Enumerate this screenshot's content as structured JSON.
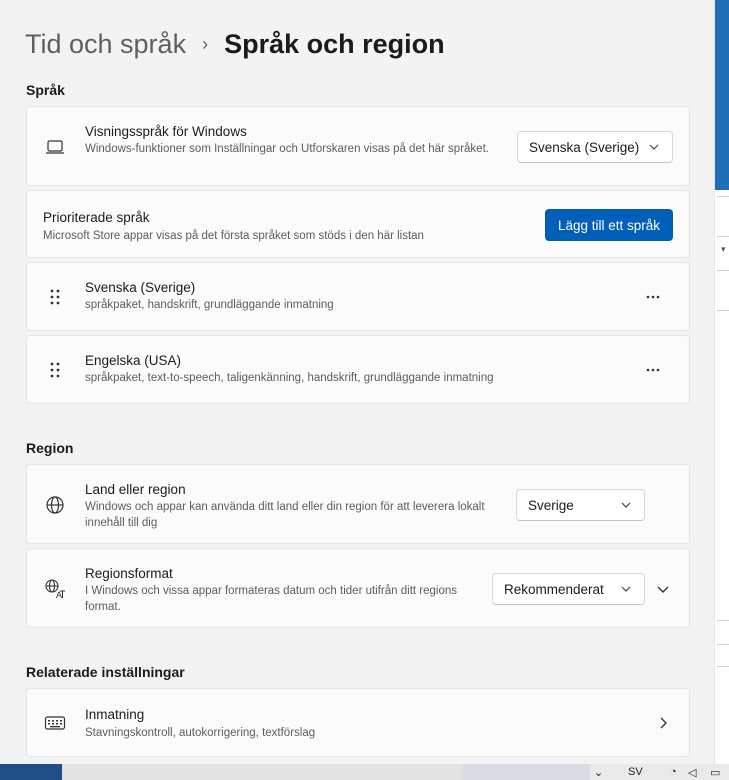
{
  "breadcrumb": {
    "parent": "Tid och språk",
    "separator": "›",
    "current": "Språk och region"
  },
  "sections": {
    "language": "Språk",
    "region": "Region",
    "related": "Relaterade inställningar"
  },
  "display_language": {
    "title": "Visningsspråk för Windows",
    "description": "Windows-funktioner som Inställningar och Utforskaren visas på det här språket.",
    "value": "Svenska (Sverige)",
    "icon": "laptop-icon"
  },
  "preferred_languages": {
    "title": "Prioriterade språk",
    "description": "Microsoft Store appar visas på det första språket som stöds i den här listan",
    "add_button": "Lägg till ett språk"
  },
  "languages": [
    {
      "name": "Svenska (Sverige)",
      "features": "språkpaket, handskrift, grundläggande inmatning"
    },
    {
      "name": "Engelska (USA)",
      "features": "språkpaket, text-to-speech, taligenkänning, handskrift, grundläggande inmatning"
    }
  ],
  "country": {
    "title": "Land eller region",
    "description": "Windows och appar kan använda ditt land eller din region för att leverera lokalt innehåll till dig",
    "value": "Sverige",
    "icon": "globe-icon"
  },
  "regional_format": {
    "title": "Regionsformat",
    "description": "I Windows och vissa appar formateras datum och tider utifrån ditt regions format.",
    "value": "Rekommenderat",
    "icon": "regional-format-icon"
  },
  "typing": {
    "title": "Inmatning",
    "description": "Stavningskontroll, autokorrigering, textförslag",
    "icon": "keyboard-icon"
  },
  "taskbar": {
    "language_indicator": "SV"
  },
  "colors": {
    "accent": "#005fb8",
    "panel_bg": "#f3f3f3",
    "card_bg": "#fbfbfb"
  }
}
